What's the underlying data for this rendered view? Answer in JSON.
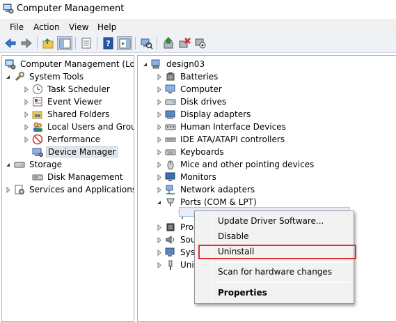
{
  "window": {
    "title": "Computer Management"
  },
  "menubar": {
    "items": [
      "File",
      "Action",
      "View",
      "Help"
    ]
  },
  "toolbar": {
    "buttons": [
      "back-icon",
      "forward-icon",
      "up-folder-icon",
      "show-hide-tree-icon",
      "properties-icon",
      "help-icon",
      "action-pane-icon",
      "scan-hardware-icon",
      "update-driver-icon",
      "uninstall-icon",
      "disable-icon"
    ]
  },
  "left_tree": {
    "root": "Computer Management (Local",
    "items": [
      {
        "label": "System Tools",
        "level": 1
      },
      {
        "label": "Task Scheduler",
        "level": 2
      },
      {
        "label": "Event Viewer",
        "level": 2
      },
      {
        "label": "Shared Folders",
        "level": 2
      },
      {
        "label": "Local Users and Groups",
        "level": 2
      },
      {
        "label": "Performance",
        "level": 2
      },
      {
        "label": "Device Manager",
        "level": 2,
        "selected": true
      },
      {
        "label": "Storage",
        "level": 1
      },
      {
        "label": "Disk Management",
        "level": 2
      },
      {
        "label": "Services and Applications",
        "level": 1
      }
    ]
  },
  "device_tree": {
    "root": "design03",
    "categories": [
      "Batteries",
      "Computer",
      "Disk drives",
      "Display adapters",
      "Human Interface Devices",
      "IDE ATA/ATAPI controllers",
      "Keyboards",
      "Mice and other pointing devices",
      "Monitors",
      "Network adapters",
      "Ports (COM & LPT)",
      "Pro",
      "Sou",
      "Sys",
      "Uni"
    ]
  },
  "context_menu": {
    "items": [
      {
        "label": "Update Driver Software..."
      },
      {
        "label": "Disable"
      },
      {
        "label": "Uninstall",
        "highlighted": true
      },
      {
        "label": "Scan for hardware changes"
      },
      {
        "label": "Properties",
        "bold": true
      }
    ],
    "highlight_color": "#e03038"
  }
}
